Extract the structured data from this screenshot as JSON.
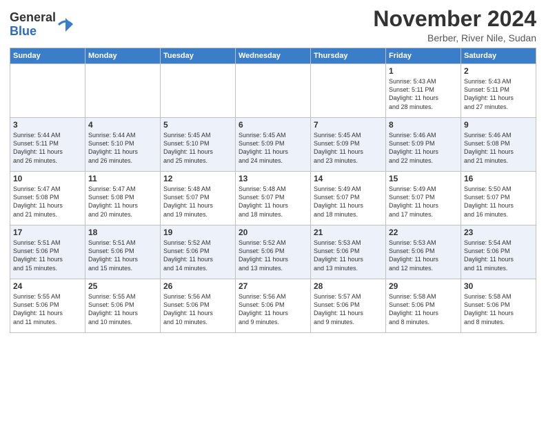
{
  "logo": {
    "general": "General",
    "blue": "Blue"
  },
  "header": {
    "month": "November 2024",
    "location": "Berber, River Nile, Sudan"
  },
  "days_of_week": [
    "Sunday",
    "Monday",
    "Tuesday",
    "Wednesday",
    "Thursday",
    "Friday",
    "Saturday"
  ],
  "weeks": [
    [
      {
        "day": "",
        "info": ""
      },
      {
        "day": "",
        "info": ""
      },
      {
        "day": "",
        "info": ""
      },
      {
        "day": "",
        "info": ""
      },
      {
        "day": "",
        "info": ""
      },
      {
        "day": "1",
        "info": "Sunrise: 5:43 AM\nSunset: 5:11 PM\nDaylight: 11 hours\nand 28 minutes."
      },
      {
        "day": "2",
        "info": "Sunrise: 5:43 AM\nSunset: 5:11 PM\nDaylight: 11 hours\nand 27 minutes."
      }
    ],
    [
      {
        "day": "3",
        "info": "Sunrise: 5:44 AM\nSunset: 5:11 PM\nDaylight: 11 hours\nand 26 minutes."
      },
      {
        "day": "4",
        "info": "Sunrise: 5:44 AM\nSunset: 5:10 PM\nDaylight: 11 hours\nand 26 minutes."
      },
      {
        "day": "5",
        "info": "Sunrise: 5:45 AM\nSunset: 5:10 PM\nDaylight: 11 hours\nand 25 minutes."
      },
      {
        "day": "6",
        "info": "Sunrise: 5:45 AM\nSunset: 5:09 PM\nDaylight: 11 hours\nand 24 minutes."
      },
      {
        "day": "7",
        "info": "Sunrise: 5:45 AM\nSunset: 5:09 PM\nDaylight: 11 hours\nand 23 minutes."
      },
      {
        "day": "8",
        "info": "Sunrise: 5:46 AM\nSunset: 5:09 PM\nDaylight: 11 hours\nand 22 minutes."
      },
      {
        "day": "9",
        "info": "Sunrise: 5:46 AM\nSunset: 5:08 PM\nDaylight: 11 hours\nand 21 minutes."
      }
    ],
    [
      {
        "day": "10",
        "info": "Sunrise: 5:47 AM\nSunset: 5:08 PM\nDaylight: 11 hours\nand 21 minutes."
      },
      {
        "day": "11",
        "info": "Sunrise: 5:47 AM\nSunset: 5:08 PM\nDaylight: 11 hours\nand 20 minutes."
      },
      {
        "day": "12",
        "info": "Sunrise: 5:48 AM\nSunset: 5:07 PM\nDaylight: 11 hours\nand 19 minutes."
      },
      {
        "day": "13",
        "info": "Sunrise: 5:48 AM\nSunset: 5:07 PM\nDaylight: 11 hours\nand 18 minutes."
      },
      {
        "day": "14",
        "info": "Sunrise: 5:49 AM\nSunset: 5:07 PM\nDaylight: 11 hours\nand 18 minutes."
      },
      {
        "day": "15",
        "info": "Sunrise: 5:49 AM\nSunset: 5:07 PM\nDaylight: 11 hours\nand 17 minutes."
      },
      {
        "day": "16",
        "info": "Sunrise: 5:50 AM\nSunset: 5:07 PM\nDaylight: 11 hours\nand 16 minutes."
      }
    ],
    [
      {
        "day": "17",
        "info": "Sunrise: 5:51 AM\nSunset: 5:06 PM\nDaylight: 11 hours\nand 15 minutes."
      },
      {
        "day": "18",
        "info": "Sunrise: 5:51 AM\nSunset: 5:06 PM\nDaylight: 11 hours\nand 15 minutes."
      },
      {
        "day": "19",
        "info": "Sunrise: 5:52 AM\nSunset: 5:06 PM\nDaylight: 11 hours\nand 14 minutes."
      },
      {
        "day": "20",
        "info": "Sunrise: 5:52 AM\nSunset: 5:06 PM\nDaylight: 11 hours\nand 13 minutes."
      },
      {
        "day": "21",
        "info": "Sunrise: 5:53 AM\nSunset: 5:06 PM\nDaylight: 11 hours\nand 13 minutes."
      },
      {
        "day": "22",
        "info": "Sunrise: 5:53 AM\nSunset: 5:06 PM\nDaylight: 11 hours\nand 12 minutes."
      },
      {
        "day": "23",
        "info": "Sunrise: 5:54 AM\nSunset: 5:06 PM\nDaylight: 11 hours\nand 11 minutes."
      }
    ],
    [
      {
        "day": "24",
        "info": "Sunrise: 5:55 AM\nSunset: 5:06 PM\nDaylight: 11 hours\nand 11 minutes."
      },
      {
        "day": "25",
        "info": "Sunrise: 5:55 AM\nSunset: 5:06 PM\nDaylight: 11 hours\nand 10 minutes."
      },
      {
        "day": "26",
        "info": "Sunrise: 5:56 AM\nSunset: 5:06 PM\nDaylight: 11 hours\nand 10 minutes."
      },
      {
        "day": "27",
        "info": "Sunrise: 5:56 AM\nSunset: 5:06 PM\nDaylight: 11 hours\nand 9 minutes."
      },
      {
        "day": "28",
        "info": "Sunrise: 5:57 AM\nSunset: 5:06 PM\nDaylight: 11 hours\nand 9 minutes."
      },
      {
        "day": "29",
        "info": "Sunrise: 5:58 AM\nSunset: 5:06 PM\nDaylight: 11 hours\nand 8 minutes."
      },
      {
        "day": "30",
        "info": "Sunrise: 5:58 AM\nSunset: 5:06 PM\nDaylight: 11 hours\nand 8 minutes."
      }
    ]
  ]
}
